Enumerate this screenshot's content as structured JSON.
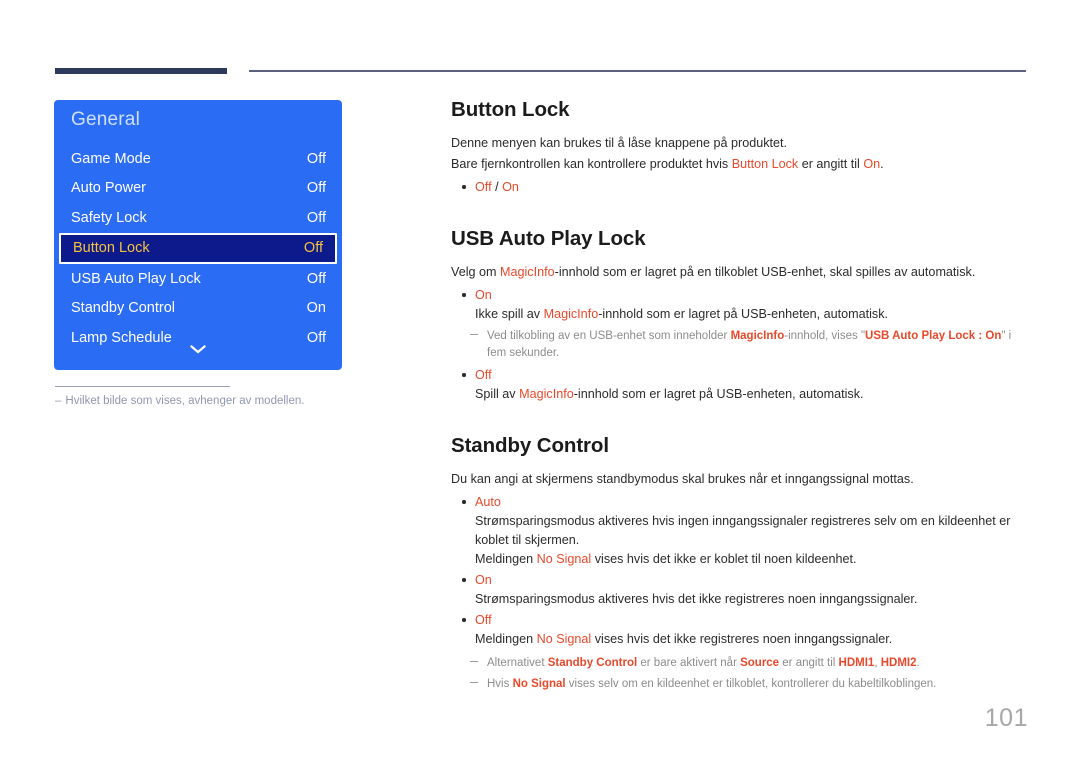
{
  "page": {
    "number": "101"
  },
  "osd": {
    "title": "General",
    "rows": [
      {
        "label": "Game Mode",
        "value": "Off",
        "selected": false
      },
      {
        "label": "Auto Power",
        "value": "Off",
        "selected": false
      },
      {
        "label": "Safety Lock",
        "value": "Off",
        "selected": false
      },
      {
        "label": "Button Lock",
        "value": "Off",
        "selected": true
      },
      {
        "label": "USB Auto Play Lock",
        "value": "Off",
        "selected": false
      },
      {
        "label": "Standby Control",
        "value": "On",
        "selected": false
      },
      {
        "label": "Lamp Schedule",
        "value": "Off",
        "selected": false
      }
    ],
    "more_icon": "chevron-down-icon"
  },
  "panel_note": {
    "dash": "–",
    "text": "Hvilket bilde som vises, avhenger av modellen."
  },
  "sections": [
    {
      "title": "Button Lock",
      "intro_1": "Denne menyen kan brukes til å låse knappene på produktet.",
      "intro_2_pre": "Bare fjernkontrollen kan kontrollere produktet hvis ",
      "intro_2_term": "Button Lock",
      "intro_2_mid": " er angitt til ",
      "intro_2_term2": "On",
      "intro_2_end": ".",
      "option_off": "Off",
      "option_sep": " / ",
      "option_on": "On"
    },
    {
      "title": "USB Auto Play Lock",
      "intro_pre": "Velg om ",
      "intro_term": "MagicInfo",
      "intro_post": "-innhold som er lagret på en tilkoblet USB-enhet, skal spilles av automatisk.",
      "opt1_term": "On",
      "opt1_desc_pre": "Ikke spill av ",
      "opt1_desc_term": "MagicInfo",
      "opt1_desc_post": "-innhold som er lagret på USB-enheten, automatisk.",
      "note_pre": "Ved tilkobling av en USB-enhet som inneholder ",
      "note_term": "MagicInfo",
      "note_mid": "-innhold, vises \"",
      "note_term2": "USB Auto Play Lock : On",
      "note_end": "\" i fem sekunder.",
      "opt2_term": "Off",
      "opt2_desc_pre": "Spill av ",
      "opt2_desc_term": "MagicInfo",
      "opt2_desc_post": "-innhold som er lagret på USB-enheten, automatisk."
    },
    {
      "title": "Standby Control",
      "intro": "Du kan angi at skjermens standbymodus skal brukes når et inngangssignal mottas.",
      "opt1_term": "Auto",
      "opt1_desc": "Strømsparingsmodus aktiveres hvis ingen inngangssignaler registreres selv om en kildeenhet er koblet til skjermen.",
      "opt1_desc2_pre": "Meldingen ",
      "opt1_desc2_term": "No Signal",
      "opt1_desc2_post": " vises hvis det ikke er koblet til noen kildeenhet.",
      "opt2_term": "On",
      "opt2_desc": "Strømsparingsmodus aktiveres hvis det ikke registreres noen inngangssignaler.",
      "opt3_term": "Off",
      "opt3_desc_pre": "Meldingen ",
      "opt3_desc_term": "No Signal",
      "opt3_desc_post": " vises hvis det ikke registreres noen inngangssignaler.",
      "note1_pre": "Alternativet ",
      "note1_term": "Standby Control",
      "note1_mid": " er bare aktivert når ",
      "note1_term2": "Source",
      "note1_mid2": " er angitt til ",
      "note1_term3": "HDMI1",
      "note1_sep": ", ",
      "note1_term4": "HDMI2",
      "note1_end": ".",
      "note2_pre": "Hvis ",
      "note2_term": "No Signal",
      "note2_post": " vises selv om en kildeenhet er tilkoblet, kontrollerer du kabeltilkoblingen."
    }
  ],
  "colors": {
    "osd_panel_blue": "#2a6cf4",
    "osd_selected_bg": "#0d1a8c",
    "osd_selected_text": "#f5c23e",
    "highlight_red": "#e8492b",
    "rule_navy": "#2e3a5c",
    "note_gray": "#8c8c8c"
  }
}
